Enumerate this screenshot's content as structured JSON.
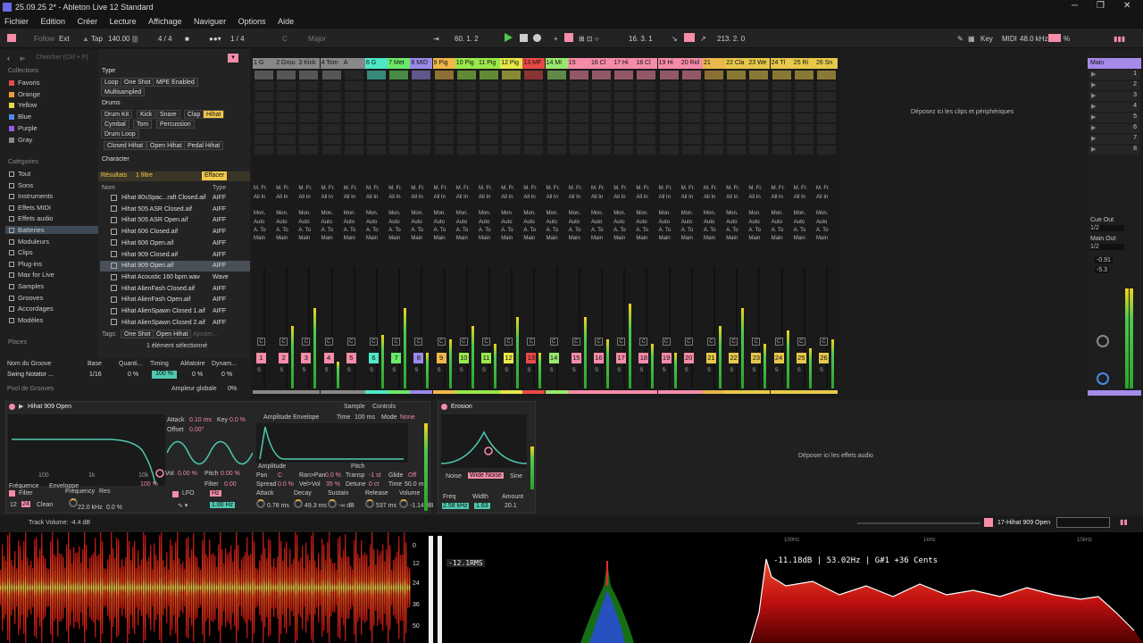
{
  "window": {
    "title": "25.09.25 2* - Ableton Live 12 Standard"
  },
  "menu": [
    "Fichier",
    "Edition",
    "Créer",
    "Lecture",
    "Affichage",
    "Naviguer",
    "Options",
    "Aide"
  ],
  "transport": {
    "follow": "Follow",
    "ext": "Ext",
    "tap": "Tap",
    "tempo": "140.00",
    "signature": "4 / 4",
    "quantize": "1 / 4",
    "key": "C",
    "scale": "Major",
    "position": "60. 1. 2",
    "loop_start": "16. 3. 1",
    "loop_len": "213. 2. 0",
    "key_label": "Key",
    "midi_label": "MIDI",
    "sample_rate": "48.0 kHz",
    "cpu": "%"
  },
  "browser": {
    "search_placeholder": "Chercher (Ctrl + F)",
    "collections_label": "Collections",
    "collections": [
      {
        "name": "Favoris",
        "color": "#e84a4a"
      },
      {
        "name": "Orange",
        "color": "#f09a3a"
      },
      {
        "name": "Yellow",
        "color": "#e8d84a"
      },
      {
        "name": "Blue",
        "color": "#4a8ae8"
      },
      {
        "name": "Purple",
        "color": "#9a5ae8"
      },
      {
        "name": "Gray",
        "color": "#888888"
      }
    ],
    "categories_label": "Catégories",
    "categories": [
      "Tout",
      "Sons",
      "Instruments",
      "Effets MIDI",
      "Effets audio",
      "Batteries",
      "Moduleurs",
      "Clips",
      "Plug-ins",
      "Max for Live",
      "Samples",
      "Grooves",
      "Accordages",
      "Modèles"
    ],
    "places_label": "Places",
    "type_label": "Type",
    "type_tags": [
      "Loop",
      "One Shot",
      "MPE Enabled",
      "Multisampled"
    ],
    "drums_label": "Drums",
    "drums_tags": [
      "Drum Kit",
      "Kick",
      "Snare",
      "Clap",
      "Hihat",
      "Cymbal",
      "Tom",
      "Percussion",
      "Drum Loop"
    ],
    "hihat_tags": [
      "Closed Hihat",
      "Open Hihat",
      "Pedal Hihat"
    ],
    "character_label": "Character",
    "results_label": "Résultats",
    "filter_count": "1 filtre",
    "clear_label": "Effacer",
    "col_name": "Nom",
    "col_type": "Type",
    "files": [
      {
        "name": "Hihat 80sSpac...raft Closed.aif",
        "type": "AIFF"
      },
      {
        "name": "Hihat 505 ASR Closed.aif",
        "type": "AIFF"
      },
      {
        "name": "Hihat 505 ASR Open.aif",
        "type": "AIFF"
      },
      {
        "name": "Hihat 606 Closed.aif",
        "type": "AIFF"
      },
      {
        "name": "Hihat 606 Open.aif",
        "type": "AIFF"
      },
      {
        "name": "Hihat 909 Closed.aif",
        "type": "AIFF"
      },
      {
        "name": "Hihat 909 Open.aif",
        "type": "AIFF"
      },
      {
        "name": "Hihat Acoustic 160 bpm.wav",
        "type": "Wave"
      },
      {
        "name": "Hihat AlienFash Closed.aif",
        "type": "AIFF"
      },
      {
        "name": "Hihat AlienFash Open.aif",
        "type": "AIFF"
      },
      {
        "name": "Hihat AlienSpawn Closed 1.aif",
        "type": "AIFF"
      },
      {
        "name": "Hihat AlienSpawn Closed 2.aif",
        "type": "AIFF"
      }
    ],
    "tags_label": "Tags:",
    "tags_selected": [
      "One Shot",
      "Open Hihat"
    ],
    "add_label": "Ajouter...",
    "selected_info": "1 élément sélectionné",
    "groove_headers": [
      "Nom du Groove",
      "Base",
      "Quanti...",
      "Timing",
      "Aléatoire",
      "Dynam..."
    ],
    "groove_row": {
      "name": "Swing Notator ...",
      "base": "1/16",
      "quant": "0 %",
      "timing": "100 %",
      "random": "0 %",
      "dyn": "0 %"
    },
    "groove_pool": "Pool de Grooves",
    "global_amount_label": "Ampleur globale",
    "global_amount": "0%"
  },
  "tracks": [
    {
      "name": "1 G",
      "color": "#888888",
      "num": "1"
    },
    {
      "name": "2 Grou",
      "color": "#888888",
      "num": "2"
    },
    {
      "name": "3 Kick",
      "color": "#888888",
      "num": "3"
    },
    {
      "name": "4 Tom",
      "color": "#888888",
      "num": "4"
    },
    {
      "name": "A",
      "color": "#888888",
      "num": "5"
    },
    {
      "name": "6 G",
      "color": "#4ee8c8",
      "num": "6"
    },
    {
      "name": "7 Met",
      "color": "#6be86b",
      "num": "7"
    },
    {
      "name": "8 MID",
      "color": "#9a8ae8",
      "num": "8"
    },
    {
      "name": "9 Pig",
      "color": "#f0b84a",
      "num": "9"
    },
    {
      "name": "10 Pig",
      "color": "#9ae84a",
      "num": "10"
    },
    {
      "name": "11 Pig",
      "color": "#9ae84a",
      "num": "11"
    },
    {
      "name": "12 Pig",
      "color": "#e8e84a",
      "num": "12"
    },
    {
      "name": "13 MF",
      "color": "#e84a4a",
      "num": "13"
    },
    {
      "name": "14 MI",
      "color": "#9ae86b",
      "num": "14"
    },
    {
      "name": "15",
      "color": "#f58ca8",
      "num": "15"
    },
    {
      "name": "16 Cl",
      "color": "#f58ca8",
      "num": "16"
    },
    {
      "name": "17 Hi",
      "color": "#f58ca8",
      "num": "17"
    },
    {
      "name": "18 Cl",
      "color": "#f58ca8",
      "num": "18"
    },
    {
      "name": "19 Hi",
      "color": "#f58ca8",
      "num": "19"
    },
    {
      "name": "20 Rid",
      "color": "#f58ca8",
      "num": "20"
    },
    {
      "name": "21",
      "color": "#e8b84a",
      "num": "21"
    },
    {
      "name": "22 Cla",
      "color": "#e8c84a",
      "num": "22"
    },
    {
      "name": "23 We",
      "color": "#e8c84a",
      "num": "23"
    },
    {
      "name": "24 Tl",
      "color": "#e8c84a",
      "num": "24"
    },
    {
      "name": "25 Ri",
      "color": "#e8c84a",
      "num": "25"
    },
    {
      "name": "26 Sn",
      "color": "#e8c84a",
      "num": "26"
    }
  ],
  "session": {
    "drop_text": "Déposez ici les clips et périphériques",
    "io_label": "A. To",
    "main_label": "Main",
    "mfr_label": "M. Fr.",
    "all_label": "All In",
    "mon_label": "Mon.",
    "auto_label": "Auto"
  },
  "master": {
    "name": "Main",
    "scenes": [
      "1",
      "2",
      "3",
      "4",
      "5",
      "6",
      "7",
      "8"
    ],
    "cue_out_label": "Cue Out",
    "cue_out": "1/2",
    "main_out_label": "Main Out",
    "main_out": "1/2",
    "db1": "-0.91",
    "db2": "-5.3"
  },
  "device": {
    "simpler_title": "Hihat 909 Open",
    "attack_label": "Attack",
    "attack": "0.10 ms",
    "key_label": "Key",
    "key": "0.0 %",
    "offset_label": "Offset",
    "offset": "0.00°",
    "freq_ticks": [
      "100",
      "1k",
      "10k"
    ],
    "vol_label": "Vol",
    "vol": "0.00 %",
    "pitch_label": "Pitch",
    "pitch": "0.00 %",
    "key2": "100 %",
    "filter_label": "Filter",
    "filter_val": "0.00",
    "freq_tag": "Fréquence",
    "env_tag": "Enveloppe",
    "filter_section": "Filter",
    "frequency_label": "Frequency",
    "res_label": "Res",
    "frequency": "22.0 kHz",
    "res": "0.0 %",
    "filter_type": "Clean",
    "filter_slope": "12",
    "filter_slope2": "24",
    "lfo_label": "LFO",
    "lfo_hz": "Hz",
    "lfo_rate": "1.00 Hz",
    "sample_tab": "Sample",
    "controls_tab": "Controls",
    "amp_env_label": "Amplitude Envelope",
    "time_label": "Time",
    "time": "100 ms",
    "mode_label": "Mode",
    "mode": "None",
    "amplitude_tag": "Amplitude",
    "pitch_tag": "Pitch",
    "pan_label": "Pan",
    "pan": "C",
    "ranpan_label": "Ran>Pan",
    "ranpan": "0.0 %",
    "transp_label": "Transp",
    "transp": "-1 st",
    "glide_label": "Glide",
    "glide": "Off",
    "spread_label": "Spread",
    "spread": "0.0 %",
    "velvol_label": "Vel>Vol",
    "velvol": "35 %",
    "detune_label": "Detune",
    "detune": "0 ct",
    "time2_label": "Time",
    "time2": "50.0 ms",
    "adsr_labels": [
      "Attack",
      "Decay",
      "Sustain",
      "Release",
      "Volume"
    ],
    "adsr_values": [
      "0.78 ms",
      "49.3 ms",
      "-∞ dB",
      "537 ms",
      "-1.14 dB"
    ],
    "erosion_title": "Erosion",
    "erosion_modes": [
      "Noise",
      "Wide Noise",
      "Sine"
    ],
    "erosion_params": [
      "Freq",
      "Width",
      "Amount"
    ],
    "erosion_values": [
      "2.58 kHz",
      "1.63",
      "20.1"
    ],
    "drop_fx": "Déposer ici les effets audio"
  },
  "status": {
    "track_volume": "Track Volume: -4.4 dB",
    "selected_track": "17-Hihat 909 Open"
  },
  "viz": {
    "rms": "-12.1RMS",
    "db_ticks": [
      "0",
      "12",
      "24",
      "36",
      "50"
    ],
    "spectrum_readout": "-11.18dB | 53.02Hz | G#1 +36 Cents",
    "freq_ticks": [
      "100Hz",
      "1kHz",
      "10kHz"
    ]
  }
}
